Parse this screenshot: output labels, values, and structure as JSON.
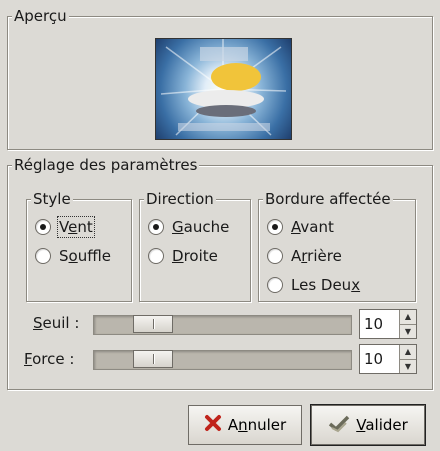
{
  "preview": {
    "title": "Aperçu"
  },
  "settings": {
    "title": "Réglage des paramètres",
    "style": {
      "title": "Style",
      "options": [
        {
          "pre": "V",
          "key": "e",
          "post": "nt",
          "checked": true
        },
        {
          "pre": "S",
          "key": "o",
          "post": "uffle",
          "checked": false
        }
      ]
    },
    "direction": {
      "title": "Direction",
      "options": [
        {
          "pre": "",
          "key": "G",
          "post": "auche",
          "checked": true
        },
        {
          "pre": "",
          "key": "D",
          "post": "roite",
          "checked": false
        }
      ]
    },
    "edge": {
      "title": "Bordure affectée",
      "options": [
        {
          "pre": "",
          "key": "A",
          "post": "vant",
          "checked": true
        },
        {
          "pre": "A",
          "key": "r",
          "post": "rière",
          "checked": false
        },
        {
          "pre": "Les Deu",
          "key": "x",
          "post": "",
          "checked": false
        }
      ]
    },
    "threshold": {
      "key": "S",
      "rest": "euil :",
      "value": "10",
      "fraction": 0.18
    },
    "strength": {
      "key": "F",
      "rest": "orce :",
      "value": "10",
      "fraction": 0.18
    }
  },
  "buttons": {
    "cancel": {
      "pre": "A",
      "key": "n",
      "post": "nuler",
      "icon": "cross-icon"
    },
    "ok": {
      "pre": "",
      "key": "V",
      "post": "alider",
      "icon": "check-icon"
    }
  },
  "colors": {
    "background": "#dcdad5",
    "cancel_icon": "#c0241c"
  }
}
